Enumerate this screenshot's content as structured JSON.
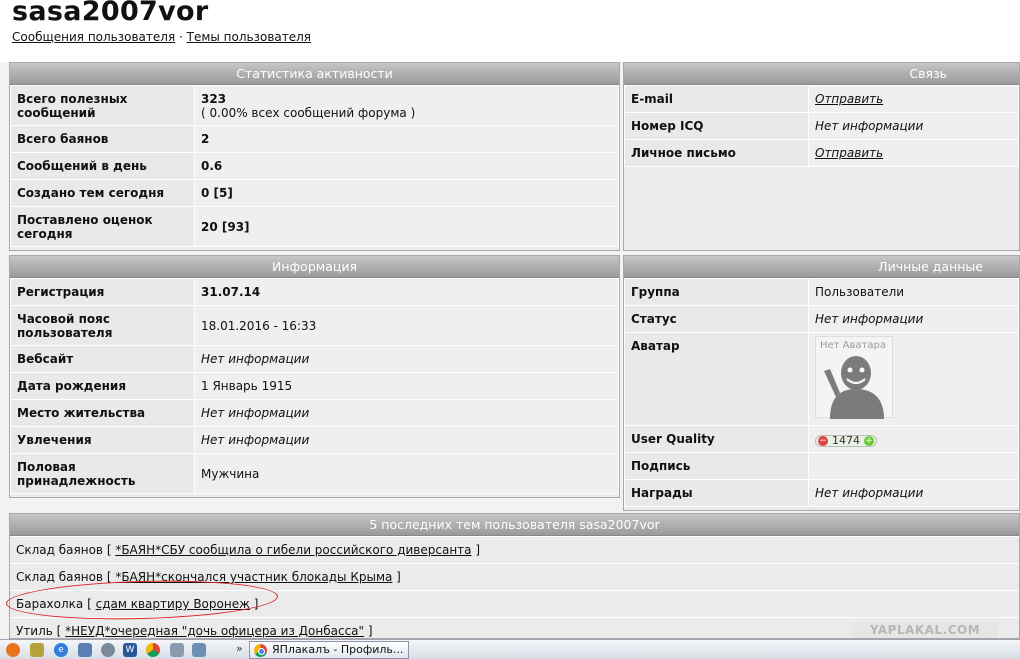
{
  "profile": {
    "username": "sasa2007vor",
    "link_messages": "Сообщения пользователя",
    "link_sep": " · ",
    "link_topics": "Темы пользователя"
  },
  "stats": {
    "title": "Статистика активности",
    "rows": [
      {
        "label": "Всего полезных сообщений",
        "value": "323",
        "sub": "( 0.00% всех сообщений форума )"
      },
      {
        "label": "Всего баянов",
        "value": "2"
      },
      {
        "label": "Сообщений в день",
        "value": "0.6"
      },
      {
        "label": "Создано тем сегодня",
        "value": "0 [5]"
      },
      {
        "label": "Поставлено оценок сегодня",
        "value": "20 [93]"
      }
    ]
  },
  "contact": {
    "title": "Связь",
    "rows": [
      {
        "label": "E-mail",
        "value": "Отправить"
      },
      {
        "label": "Номер ICQ",
        "value": "Нет информации"
      },
      {
        "label": "Личное письмо",
        "value": "Отправить"
      }
    ]
  },
  "info": {
    "title": "Информация",
    "rows": [
      {
        "label": "Регистрация",
        "value": "31.07.14"
      },
      {
        "label": "Часовой пояс пользователя",
        "value": "18.01.2016 - 16:33"
      },
      {
        "label": "Вебсайт",
        "value": "Нет информации"
      },
      {
        "label": "Дата рождения",
        "value": "1 Январь 1915"
      },
      {
        "label": "Место жительства",
        "value": "Нет информации"
      },
      {
        "label": "Увлечения",
        "value": "Нет информации"
      },
      {
        "label": "Половая принадлежность",
        "value": "Мужчина"
      }
    ]
  },
  "personal": {
    "title": "Личные данные",
    "rows": [
      {
        "label": "Группа",
        "value": "Пользователи"
      },
      {
        "label": "Статус",
        "value": "Нет информации"
      },
      {
        "label": "Аватар",
        "value": "Нет Аватара"
      },
      {
        "label": "User Quality",
        "value": "1474",
        "minus": "−",
        "plus": "+"
      },
      {
        "label": "Подпись",
        "value": ""
      },
      {
        "label": "Награды",
        "value": "Нет информации"
      }
    ]
  },
  "last_topics": {
    "title": "5 последних тем пользователя sasa2007vor",
    "rows": [
      {
        "forum": "Склад баянов",
        "topic": "*БАЯН*СБУ сообщила о гибели российского диверсанта"
      },
      {
        "forum": "Склад баянов",
        "topic": "*БАЯН*скончался участник блокады Крыма"
      },
      {
        "forum": "Барахолка",
        "topic": "сдам квартиру Воронеж"
      },
      {
        "forum": "Утиль",
        "topic": "*НЕУД*очередная \"дочь офицера из Донбасса\""
      }
    ],
    "open_bracket": " [ ",
    "close_bracket": " ]"
  },
  "watermark": "YAPLAKAL.COM",
  "taskbar": {
    "overflow": "»",
    "active_task": "ЯПлакалъ - Профиль..."
  },
  "colors": {
    "header_gradient_top": "#c6c6c6",
    "header_gradient_bottom": "#9a9a9a",
    "highlight_ellipse": "#dd2222"
  }
}
